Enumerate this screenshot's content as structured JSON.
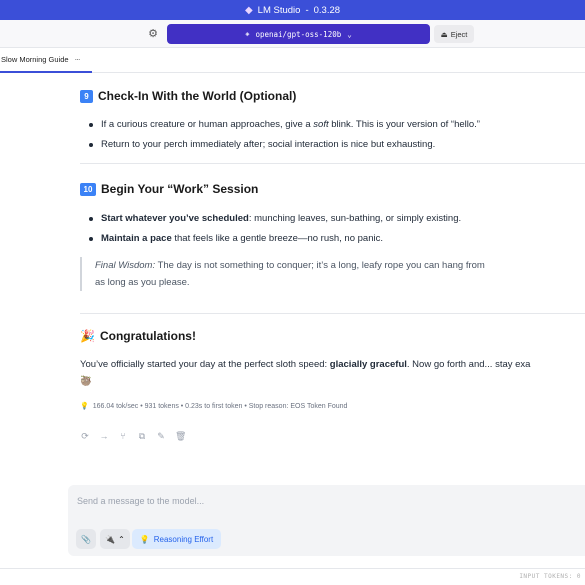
{
  "app": {
    "title": "LM Studio",
    "version": "0.3.28"
  },
  "toolbar": {
    "model": "openai/gpt-oss-120b",
    "eject_label": "Eject"
  },
  "tab": {
    "label": "Slow Morning Guide"
  },
  "sections": [
    {
      "number": "9",
      "title": "Check-In With the World (Optional)",
      "bullets": [
        {
          "pre": "If a curious creature or human approaches, give a ",
          "em": "soft",
          "post": " blink. This is your version of “hello.”"
        },
        {
          "text": "Return to your perch immediately after; social interaction is nice but exhausting."
        }
      ]
    },
    {
      "number": "10",
      "title": "Begin Your “Work” Session",
      "bullets": [
        {
          "bold": "Start whatever you’ve scheduled",
          "post": ": munching leaves, sun-bathing, or simply existing."
        },
        {
          "bold": "Maintain a pace",
          "post": " that feels like a gentle breeze—no rush, no panic."
        }
      ]
    }
  ],
  "quote": {
    "lead": "Final Wisdom:",
    "line1": " The day is not something to conquer; it’s a long, leafy rope you can hang from",
    "line2": "as long as you please."
  },
  "congrats": {
    "emoji": "🎉",
    "title": "Congratulations!",
    "pre": "You’ve officially started your day at the perfect sloth speed: ",
    "bold": "glacially graceful",
    "post": ". Now go forth and... stay exa",
    "emoji2": "🦥"
  },
  "stats": "166.04 tok/sec • 931 tokens • 0.23s to first token • Stop reason: EOS Token Found",
  "composer": {
    "placeholder": "Send a message to the model...",
    "reasoning_label": "Reasoning Effort"
  },
  "footer": {
    "tokens_label": "INPUT TOKENS: 0"
  }
}
